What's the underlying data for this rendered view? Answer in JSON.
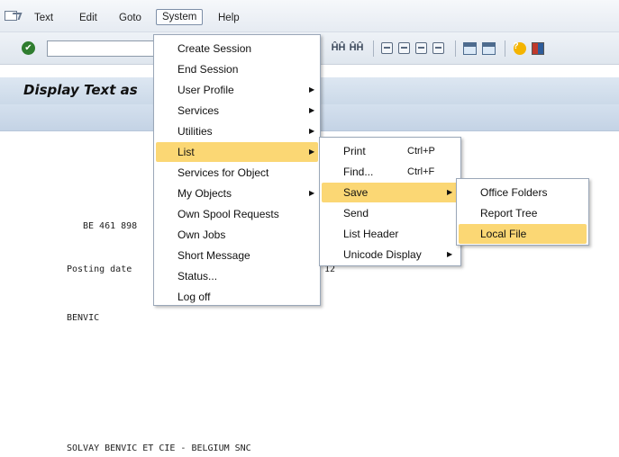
{
  "menubar": {
    "items": [
      {
        "id": "text",
        "label": "Text"
      },
      {
        "id": "edit",
        "label": "Edit"
      },
      {
        "id": "goto",
        "label": "Goto"
      },
      {
        "id": "system",
        "label": "System",
        "active": true
      },
      {
        "id": "help",
        "label": "Help"
      }
    ]
  },
  "toolbar": {
    "command_value": "",
    "icons": [
      "enter-check-icon",
      "find-icon",
      "find-next-icon",
      "first-page-icon",
      "previous-page-icon",
      "next-page-icon",
      "last-page-icon",
      "create-session-icon",
      "shortcut-icon",
      "help-icon",
      "customize-layout-icon"
    ]
  },
  "screen": {
    "title": "Display Text as",
    "lines": {
      "vat": "BE 461 898",
      "posting": "Posting date",
      "posting_tail": "12",
      "benvic": "BENVIC",
      "company": "SOLVAY BENVIC ET CIE - BELGIUM SNC"
    }
  },
  "system_menu": {
    "items": [
      {
        "label": "Create Session",
        "submenu": false
      },
      {
        "label": "End Session",
        "submenu": false
      },
      {
        "label": "User Profile",
        "submenu": true
      },
      {
        "label": "Services",
        "submenu": true
      },
      {
        "label": "Utilities",
        "submenu": true
      },
      {
        "label": "List",
        "submenu": true,
        "highlighted": true
      },
      {
        "label": "Services for Object",
        "submenu": false
      },
      {
        "label": "My Objects",
        "submenu": true
      },
      {
        "label": "Own Spool Requests",
        "submenu": false
      },
      {
        "label": "Own Jobs",
        "submenu": false
      },
      {
        "label": "Short Message",
        "submenu": false
      },
      {
        "label": "Status...",
        "submenu": false
      },
      {
        "label": "Log off",
        "submenu": false
      }
    ]
  },
  "list_menu": {
    "items": [
      {
        "label": "Print",
        "shortcut": "Ctrl+P",
        "submenu": false
      },
      {
        "label": "Find...",
        "shortcut": "Ctrl+F",
        "submenu": false
      },
      {
        "label": "Save",
        "shortcut": "",
        "submenu": true,
        "highlighted": true
      },
      {
        "label": "Send",
        "shortcut": "",
        "submenu": false
      },
      {
        "label": "List Header",
        "shortcut": "",
        "submenu": false
      },
      {
        "label": "Unicode Display",
        "shortcut": "",
        "submenu": true
      }
    ]
  },
  "save_menu": {
    "items": [
      {
        "label": "Office Folders"
      },
      {
        "label": "Report Tree"
      },
      {
        "label": "Local File",
        "highlighted": true
      }
    ]
  },
  "colors": {
    "highlight": "#fbd774",
    "menubar": "#eef2f7",
    "titlebar": "#d4e0ee"
  }
}
